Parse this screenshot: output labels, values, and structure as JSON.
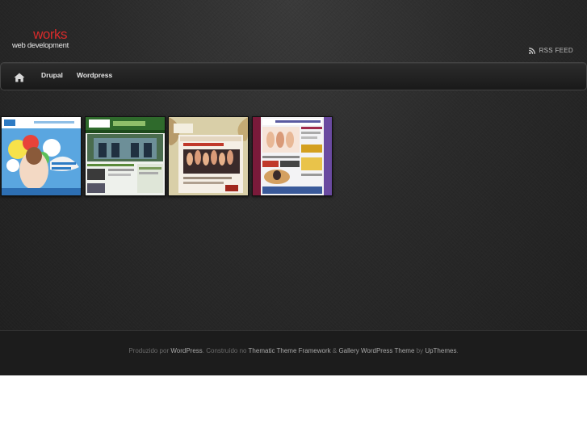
{
  "header": {
    "logo": {
      "title": "works",
      "subtitle": "web development"
    },
    "rss_label": "RSS FEED"
  },
  "nav": {
    "items": [
      {
        "label": "Drupal"
      },
      {
        "label": "Wordpress"
      }
    ]
  },
  "colors": {
    "logo_accent": "#d62b2b",
    "background": "#2a2a2a",
    "footer_background": "#1c1c1c"
  },
  "icons": {
    "home": "home-icon",
    "rss": "rss-icon"
  },
  "footer": {
    "t1": "Produzido por ",
    "l1": "WordPress",
    "t2": ". Construído no ",
    "l2": "Thematic Theme Framework",
    "t3": " & ",
    "l3": "Gallery WordPress Theme",
    "t4": " by ",
    "l4": "UpThemes",
    "t5": "."
  }
}
